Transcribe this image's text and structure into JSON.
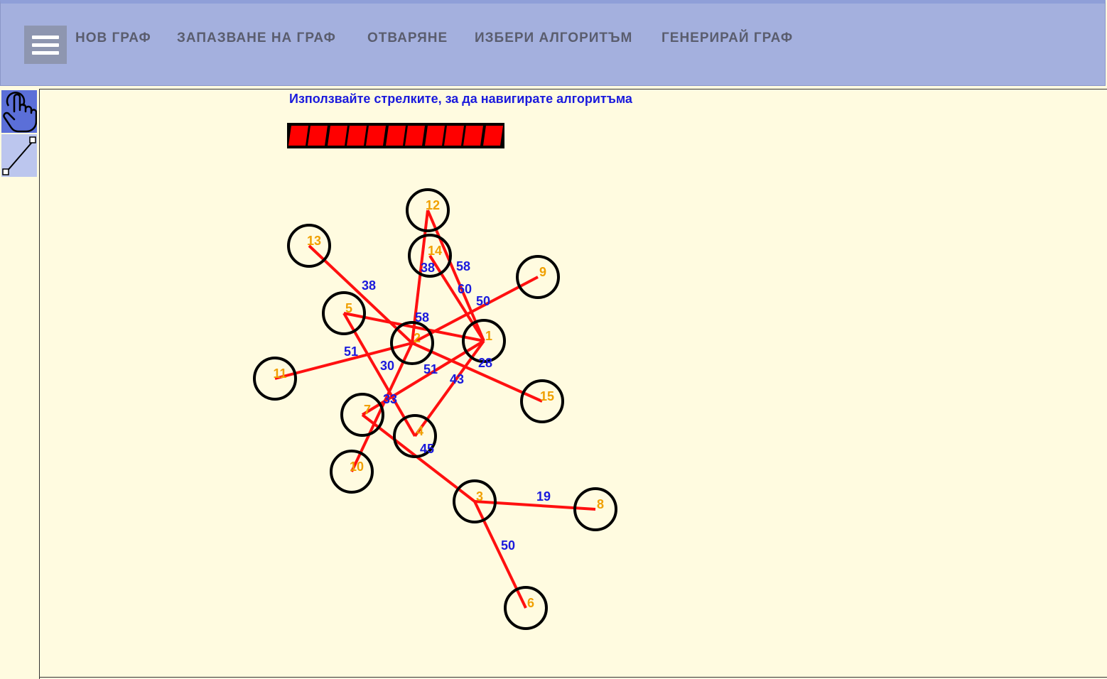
{
  "menu": {
    "items": [
      "НОВ ГРАФ",
      "ЗАПАЗВАНЕ НА ГРАФ",
      "ОТВАРЯНЕ",
      "ИЗБЕРИ АЛГОРИТЪМ",
      "ГЕНЕРИРАЙ ГРАФ"
    ]
  },
  "tools": [
    {
      "name": "pointer-tool",
      "icon": "hand-pointer-icon",
      "active": true
    },
    {
      "name": "edge-tool",
      "icon": "line-segment-icon",
      "active": false
    }
  ],
  "hint": "Използвайте стрелките, за да навигирате алгоритъма",
  "progress": {
    "segments": 11,
    "filled": 11
  },
  "colors": {
    "edge": "#ff1010",
    "node_stroke": "#000000",
    "node_label": "#f0a000",
    "weight_label": "#1a1adc",
    "header_bg": "#a4b0de",
    "canvas_bg": "#fffbe0"
  },
  "graph": {
    "nodes": [
      {
        "id": "1"
      },
      {
        "id": "2"
      },
      {
        "id": "3"
      },
      {
        "id": "4"
      },
      {
        "id": "5"
      },
      {
        "id": "6"
      },
      {
        "id": "7"
      },
      {
        "id": "8"
      },
      {
        "id": "9"
      },
      {
        "id": "10"
      },
      {
        "id": "11"
      },
      {
        "id": "12"
      },
      {
        "id": "13"
      },
      {
        "id": "14"
      },
      {
        "id": "15"
      }
    ],
    "edges": [
      {
        "from": "12",
        "to": "2",
        "weight": "38"
      },
      {
        "from": "12",
        "to": "1",
        "weight": "58"
      },
      {
        "from": "14",
        "to": "1",
        "weight": "60"
      },
      {
        "from": "13",
        "to": "2",
        "weight": "38"
      },
      {
        "from": "9",
        "to": "2",
        "weight": "50"
      },
      {
        "from": "5",
        "to": "1",
        "weight": "58"
      },
      {
        "from": "11",
        "to": "2",
        "weight": "51"
      },
      {
        "from": "2",
        "to": "10",
        "weight": "30"
      },
      {
        "from": "1",
        "to": "7",
        "weight": "51"
      },
      {
        "from": "2",
        "to": "15",
        "weight": "28"
      },
      {
        "from": "1",
        "to": "4",
        "weight": "43"
      },
      {
        "from": "5",
        "to": "4",
        "weight": "33"
      },
      {
        "from": "7",
        "to": "3",
        "weight": "45"
      },
      {
        "from": "3",
        "to": "8",
        "weight": "19"
      },
      {
        "from": "3",
        "to": "6",
        "weight": "50"
      }
    ]
  }
}
